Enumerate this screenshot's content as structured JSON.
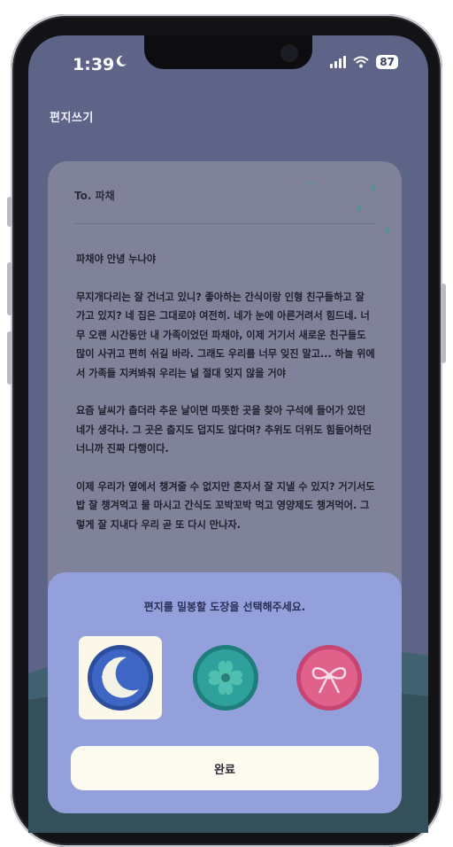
{
  "status_bar": {
    "time": "1:39",
    "battery": "87"
  },
  "page": {
    "title": "편지쓰기"
  },
  "letter": {
    "to": "To. 파채",
    "paragraphs": [
      "파채야 안녕 누나야",
      "무지개다리는 잘 건너고 있니? 좋아하는 간식이랑 인형 친구들하고 잘 가고 있지? 네 집은 그대로야 여전히. 네가 눈에 아른거려서 힘드네. 너무 오랜 시간동안 내 가족이었던 파채야, 이제 거기서 새로운 친구들도 많이 사귀고 편히 쉬길 바라. 그래도 우리를 너무 잊진 말고... 하늘 위에서 가족들 지켜봐줘 우리는 널 절대 잊지 않을 거야",
      "요즘 날씨가 춥더라 추운 날이면 따뜻한 곳을 찾아 구석에 들어가 있던 네가 생각나. 그 곳은 춥지도 덥지도 않다며? 추위도 더위도 힘들어하던 너니까 진짜 다행이다.",
      "이제 우리가 옆에서 챙겨줄 수 없지만 혼자서 잘 지낼 수 있지? 거기서도 밥 잘 챙겨먹고 물 마시고 간식도 꼬박꼬박 먹고 영양제도 챙겨먹어. 그렇게 잘 지내다 우리 곧 또 다시 만나자."
    ]
  },
  "stamp_sheet": {
    "prompt": "편지를 밀봉할 도장을 선택해주세요.",
    "stamps": [
      {
        "icon": "moon-stamp-icon",
        "color": "#3b5fb8",
        "selected": true
      },
      {
        "icon": "clover-stamp-icon",
        "color": "#2b9a97",
        "selected": false
      },
      {
        "icon": "ribbon-stamp-icon",
        "color": "#e0628a",
        "selected": false
      }
    ],
    "done_label": "완료"
  },
  "colors": {
    "background": "#5d6488",
    "letter": "#80829a",
    "sheet": "#93a0dc",
    "button": "#fdfbef"
  }
}
